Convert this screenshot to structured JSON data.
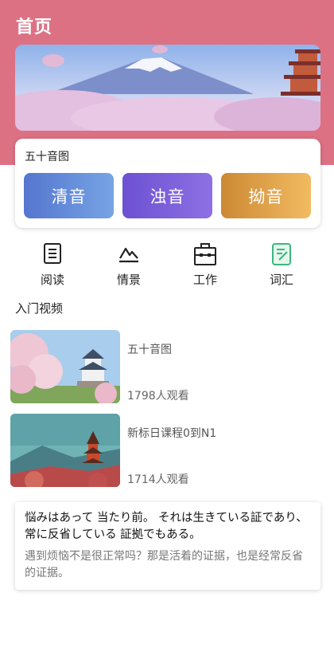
{
  "header": {
    "title": "首页"
  },
  "kana": {
    "title": "五十音图",
    "buttons": [
      "清音",
      "浊音",
      "拗音"
    ]
  },
  "nav": [
    {
      "label": "阅读",
      "icon": "document-icon"
    },
    {
      "label": "情景",
      "icon": "mountain-icon"
    },
    {
      "label": "工作",
      "icon": "briefcase-icon"
    },
    {
      "label": "词汇",
      "icon": "vocabulary-icon"
    }
  ],
  "section": {
    "title": "入门视频"
  },
  "videos": [
    {
      "title": "五十音图",
      "views": "1798人观看"
    },
    {
      "title": "新标日课程0到N1",
      "views": "1714人观看"
    }
  ],
  "quote": {
    "jp": "悩みはあって 当たり前。 それは生きている証であり、 常に反省している 証拠でもある。",
    "cn": "遇到烦恼不是很正常吗？那是活着的证据，也是经常反省的证据。"
  },
  "colors": {
    "header": "#dd7184",
    "qingyin": "#5576cf",
    "zhuoyin": "#6c51d2",
    "aoyin": "#cc8934",
    "vocab_icon": "#3bb77e"
  }
}
